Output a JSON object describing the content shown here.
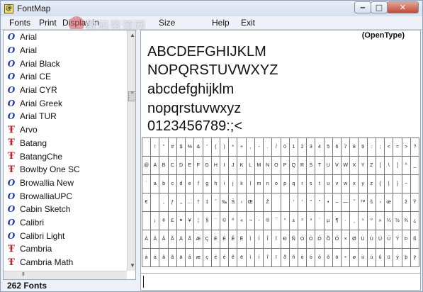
{
  "window": {
    "app_icon": "@",
    "title": "FontMap"
  },
  "menu": {
    "items": [
      "Fonts",
      "Print",
      "Display in",
      "Size",
      "",
      "Help",
      "Exit"
    ]
  },
  "watermark": "数码资源网",
  "font_list": {
    "items": [
      {
        "name": "Arial",
        "icon": "opentype-icon"
      },
      {
        "name": "Arial",
        "icon": "opentype-icon"
      },
      {
        "name": "Arial Black",
        "icon": "opentype-icon"
      },
      {
        "name": "Arial CE",
        "icon": "opentype-icon"
      },
      {
        "name": "Arial CYR",
        "icon": "opentype-icon"
      },
      {
        "name": "Arial Greek",
        "icon": "opentype-icon"
      },
      {
        "name": "Arial TUR",
        "icon": "opentype-icon"
      },
      {
        "name": "Arvo",
        "icon": "truetype-icon"
      },
      {
        "name": "Batang",
        "icon": "truetype-icon"
      },
      {
        "name": "BatangChe",
        "icon": "truetype-icon"
      },
      {
        "name": "Bowlby One SC",
        "icon": "truetype-icon"
      },
      {
        "name": "Browallia New",
        "icon": "opentype-icon"
      },
      {
        "name": "BrowalliaUPC",
        "icon": "opentype-icon"
      },
      {
        "name": "Cabin Sketch",
        "icon": "opentype-icon"
      },
      {
        "name": "Calibri",
        "icon": "opentype-icon"
      },
      {
        "name": "Calibri Light",
        "icon": "opentype-icon"
      },
      {
        "name": "Cambria",
        "icon": "truetype-icon"
      },
      {
        "name": "Cambria Math",
        "icon": "truetype-icon"
      }
    ],
    "icon_glyphs": {
      "opentype-icon": "O",
      "truetype-icon": "Ŧ"
    },
    "scroll_up": "▲",
    "scroll_down": "▼",
    "scroll_thumb": "≡",
    "hscroll_thumb": "III"
  },
  "status": {
    "count": "262 Fonts"
  },
  "preview": {
    "font_type": "(OpenType)",
    "sample_lines": [
      "ABCDEFGHIJKLM",
      "NOPQRSTUVWXYZ",
      "abcdefghijklm",
      "nopqrstuvwxyz",
      "0123456789:;<"
    ],
    "glyph_rows": [
      [
        "",
        "!",
        "\"",
        "#",
        "$",
        "%",
        "&",
        "'",
        "(",
        ")",
        "*",
        "+",
        ",",
        "-",
        ".",
        "/",
        "0",
        "1",
        "2",
        "3",
        "4",
        "5",
        "6",
        "7",
        "8",
        "9",
        ":",
        ";",
        "<",
        "=",
        ">",
        "?"
      ],
      [
        "@",
        "A",
        "B",
        "C",
        "D",
        "E",
        "F",
        "G",
        "H",
        "I",
        "J",
        "K",
        "L",
        "M",
        "N",
        "O",
        "P",
        "Q",
        "R",
        "S",
        "T",
        "U",
        "V",
        "W",
        "X",
        "Y",
        "Z",
        "[",
        "\\",
        "]",
        "^",
        "_"
      ],
      [
        "`",
        "a",
        "b",
        "c",
        "d",
        "e",
        "f",
        "g",
        "h",
        "i",
        "j",
        "k",
        "l",
        "m",
        "n",
        "o",
        "p",
        "q",
        "r",
        "s",
        "t",
        "u",
        "v",
        "w",
        "x",
        "y",
        "z",
        "{",
        "|",
        "}",
        "~",
        ""
      ],
      [
        "€",
        "",
        "‚",
        "ƒ",
        "„",
        "…",
        "†",
        "‡",
        "ˆ",
        "‰",
        "Š",
        "‹",
        "Œ",
        "",
        "Ž",
        "",
        "",
        "'",
        "'",
        "\"",
        "\"",
        "•",
        "–",
        "—",
        "˜",
        "™",
        "š",
        "›",
        "œ",
        "",
        "ž",
        "Ÿ"
      ],
      [
        "",
        "¡",
        "¢",
        "£",
        "¤",
        "¥",
        "¦",
        "§",
        "¨",
        "©",
        "ª",
        "«",
        "¬",
        "-",
        "®",
        "¯",
        "°",
        "±",
        "²",
        "³",
        "´",
        "µ",
        "¶",
        "·",
        "¸",
        "¹",
        "º",
        "»",
        "¼",
        "½",
        "¾",
        "¿"
      ],
      [
        "À",
        "Á",
        "Â",
        "Ã",
        "Ä",
        "Å",
        "Æ",
        "Ç",
        "È",
        "É",
        "Ê",
        "Ë",
        "Ì",
        "Í",
        "Î",
        "Ï",
        "Ð",
        "Ñ",
        "Ò",
        "Ó",
        "Ô",
        "Õ",
        "Ö",
        "×",
        "Ø",
        "Ù",
        "Ú",
        "Û",
        "Ü",
        "Ý",
        "Þ",
        "ß"
      ],
      [
        "à",
        "á",
        "â",
        "ã",
        "ä",
        "å",
        "æ",
        "ç",
        "è",
        "é",
        "ê",
        "ë",
        "ì",
        "í",
        "î",
        "ï",
        "ð",
        "ñ",
        "ò",
        "ó",
        "ô",
        "õ",
        "ö",
        "÷",
        "ø",
        "ù",
        "ú",
        "û",
        "ü",
        "ý",
        "þ",
        "ÿ"
      ]
    ],
    "input_value": ""
  }
}
